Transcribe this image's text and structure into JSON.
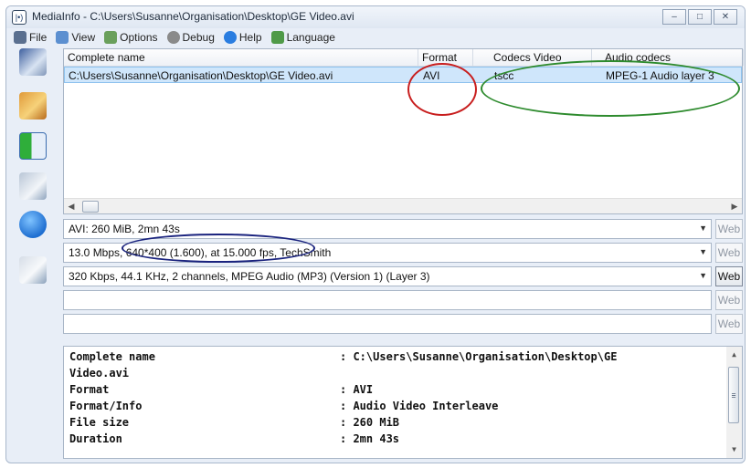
{
  "window": {
    "title": "MediaInfo - C:\\Users\\Susanne\\Organisation\\Desktop\\GE Video.avi",
    "app_icon": "|•)",
    "controls": {
      "minimize": "–",
      "maximize": "□",
      "close": "✕"
    }
  },
  "menu": {
    "items": [
      {
        "label": "File",
        "icon": "file-menu-icon",
        "color": "#5a6f8f"
      },
      {
        "label": "View",
        "icon": "view-menu-icon",
        "color": "#5b8fd0"
      },
      {
        "label": "Options",
        "icon": "options-menu-icon",
        "color": "#6aa05c"
      },
      {
        "label": "Debug",
        "icon": "debug-menu-icon",
        "color": "#8a8a8a"
      },
      {
        "label": "Help",
        "icon": "help-menu-icon",
        "color": "#2a7de0"
      },
      {
        "label": "Language",
        "icon": "language-menu-icon",
        "color": "#4f9a48"
      }
    ]
  },
  "sidebar": {
    "buttons": [
      "open-file-icon",
      "open-folder-icon",
      "export-icon",
      "tree-view-icon",
      "about-icon",
      "knowledge-base-icon"
    ]
  },
  "grid": {
    "columns": [
      "Complete name",
      "Format",
      "Codecs Video",
      "Audio codecs"
    ],
    "rows": [
      {
        "complete_name": "C:\\Users\\Susanne\\Organisation\\Desktop\\GE Video.avi",
        "format": "AVI",
        "codecs_video": "tscc",
        "audio_codecs": "MPEG-1 Audio layer 3"
      }
    ],
    "scroll": {
      "left": "◀",
      "right": "▶"
    }
  },
  "summaries": [
    {
      "text": "AVI: 260 MiB, 2mn 43s",
      "web": "Web",
      "web_enabled": false
    },
    {
      "text": "13.0 Mbps, 640*400 (1.600), at 15.000 fps, TechSmith",
      "web": "Web",
      "web_enabled": false
    },
    {
      "text": "320 Kbps, 44.1 KHz, 2 channels, MPEG Audio (MP3) (Version 1) (Layer 3)",
      "web": "Web",
      "web_enabled": true
    },
    {
      "text": "",
      "web": "Web",
      "web_enabled": false
    },
    {
      "text": "",
      "web": "Web",
      "web_enabled": false
    }
  ],
  "dropdown_arrow": "▼",
  "info": {
    "lines": [
      {
        "label": "Complete name",
        "value": ": C:\\Users\\Susanne\\Organisation\\Desktop\\GE"
      },
      {
        "label": "Video.avi",
        "value": ""
      },
      {
        "label": "Format",
        "value": ": AVI"
      },
      {
        "label": "Format/Info",
        "value": ": Audio Video Interleave"
      },
      {
        "label": "File size",
        "value": ": 260 MiB"
      },
      {
        "label": "Duration",
        "value": ": 2mn 43s"
      }
    ],
    "scroll": {
      "up": "▲",
      "down": "▼",
      "grip": "≡"
    }
  },
  "annotations": {
    "red": "#c81e1e",
    "green": "#2e8b2e",
    "blue": "#1a237e"
  }
}
